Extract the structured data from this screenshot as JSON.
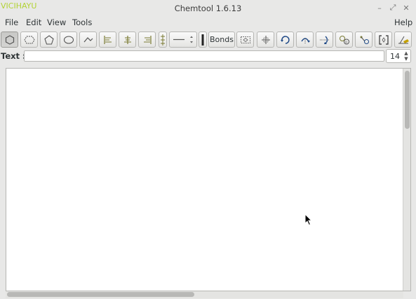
{
  "window": {
    "corner_label": "VICIHAYU",
    "title": "Chemtool 1.6.13",
    "controls": {
      "minimize": "–",
      "maximize": "⤢",
      "close": "✕"
    }
  },
  "menubar": {
    "file": "File",
    "edit": "Edit",
    "view": "View",
    "tools": "Tools",
    "help": "Help"
  },
  "toolbar": {
    "bonds_label": "Bonds",
    "tools": [
      "draw-hexagon",
      "draw-hexagon-open",
      "draw-pentagon",
      "draw-circle",
      "draw-chain",
      "align-left",
      "align-center",
      "align-right",
      "text-orientation",
      "line-style",
      "line-width",
      "bonds",
      "select-area",
      "move",
      "rotate",
      "flip-vertical",
      "flip-horizontal",
      "bond-label",
      "atom-label",
      "brackets",
      "delete"
    ]
  },
  "textrow": {
    "label": "Text :",
    "value": "",
    "font_size": "14"
  },
  "colors": {
    "accent_label": "#b2d235",
    "icon_olive": "#7a7a32",
    "icon_blue": "#204a87"
  }
}
